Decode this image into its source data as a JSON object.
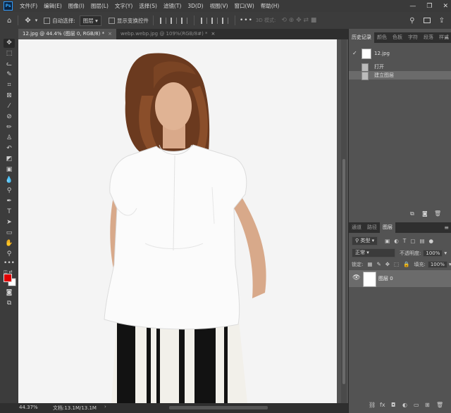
{
  "app": {
    "logo": "Ps"
  },
  "menu": [
    "文件(F)",
    "编辑(E)",
    "图像(I)",
    "图层(L)",
    "文字(Y)",
    "选择(S)",
    "滤镜(T)",
    "3D(D)",
    "视图(V)",
    "窗口(W)",
    "帮助(H)"
  ],
  "window_controls": {
    "minimize": "—",
    "restore": "❐",
    "close": "✕"
  },
  "options": {
    "auto_select_label": "自动选择:",
    "auto_select_value": "图层",
    "show_transform_label": "显示变换控件",
    "mode_3d_label": "3D 模式:",
    "more": "•••"
  },
  "tabs": [
    {
      "label": "12.jpg @ 44.4% (图层 0, RGB/8) *",
      "close": "×"
    },
    {
      "label": "webp.webp.jpg @ 109%(RGB/8#) *",
      "close": "×"
    }
  ],
  "status": {
    "zoom": "44.37%",
    "doc": "文档:13.1M/13.1M"
  },
  "history_panel": {
    "tabs": [
      "历史记录",
      "颜色",
      "色板",
      "字符",
      "段落",
      "样式"
    ],
    "snapshot": "12.jpg",
    "items": [
      "打开",
      "建立图层"
    ]
  },
  "layers_panel": {
    "tabs": [
      "通道",
      "路径",
      "图层"
    ],
    "filter_label": "类型",
    "blend_mode": "正常",
    "opacity_label": "不透明度:",
    "opacity_value": "100%",
    "lock_label": "锁定:",
    "fill_label": "填充:",
    "fill_value": "100%",
    "layers": [
      {
        "name": "图层 0",
        "visible": true
      }
    ]
  },
  "colors": {
    "foreground": "#e00000",
    "background": "#ffffff",
    "accent": "#31a8ff"
  }
}
